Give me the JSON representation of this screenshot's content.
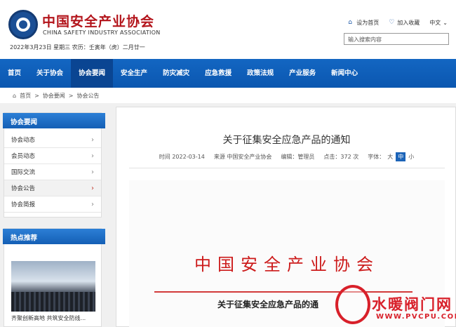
{
  "site": {
    "title_cn": "中国安全产业协会",
    "title_en": "CHINA SAFETY INDUSTRY ASSOCIATION",
    "date": "2022年3月23日 星期三 农历：壬寅年（虎）二月廿一",
    "links": {
      "homepage": "设为首页",
      "favorite": "加入收藏",
      "lang": "中文"
    },
    "search_placeholder": "输入搜索内容"
  },
  "nav": [
    "首页",
    "关于协会",
    "协会要闻",
    "安全生产",
    "防灾减灾",
    "应急救援",
    "政策法规",
    "产业服务",
    "新闻中心"
  ],
  "breadcrumb": [
    "首页",
    ">",
    "协会要闻",
    ">",
    "协会公告"
  ],
  "sidebar": {
    "title": "协会要闻",
    "items": [
      "协会动态",
      "会员动态",
      "国际交流",
      "协会公告",
      "协会简报"
    ]
  },
  "hot": {
    "title": "热点推荐",
    "caption": "齐聚创新高地 共筑安全防线..."
  },
  "article": {
    "title": "关于征集安全应急产品的通知",
    "time": "时间 2022-03-14",
    "source": "来源 中国安全产业协会",
    "editor": "编辑：管理员",
    "clicks": "点击：372 次",
    "font_label": "字体：",
    "sizes": [
      "大",
      "中",
      "小"
    ]
  },
  "document": {
    "heading": "中国安全产业协会",
    "subheading": "关于征集安全应急产品的通"
  },
  "watermark": {
    "text": "水暖阀门网",
    "url": "WWW.PVCPU.COM"
  },
  "colors": {
    "nav": "#0b57b0",
    "title_red": "#b3141b"
  }
}
